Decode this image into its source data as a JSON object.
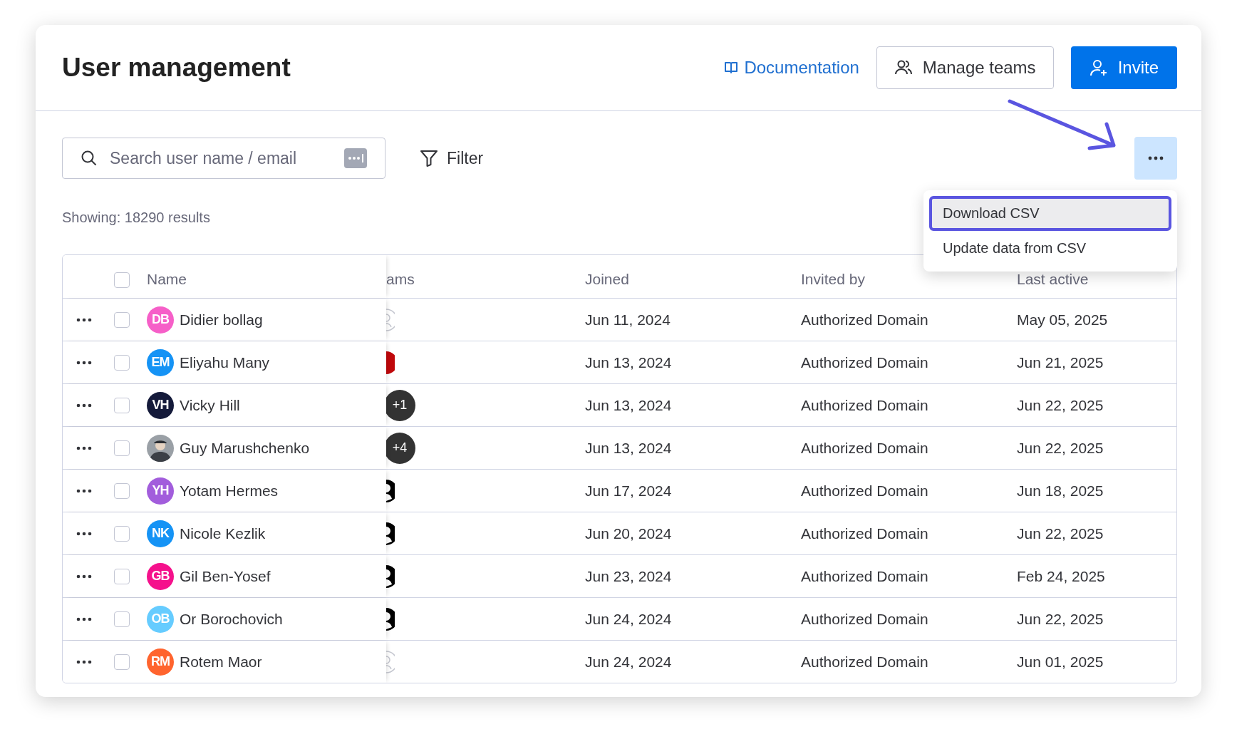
{
  "header": {
    "title": "User management",
    "documentation_link": "Documentation",
    "manage_teams_button": "Manage teams",
    "invite_button": "Invite"
  },
  "toolbar": {
    "search": {
      "placeholder": "Search user name / email"
    },
    "filter_button": "Filter",
    "more_button": {
      "expanded": true
    }
  },
  "results_summary": "Showing: 18290 results",
  "menu": {
    "items": [
      {
        "label": "Download CSV",
        "highlighted": true
      },
      {
        "label": "Update data from CSV",
        "highlighted": false
      }
    ]
  },
  "table": {
    "select_all_checked": false,
    "columns": [
      "Name",
      "ams",
      "Joined",
      "Invited by",
      "Last active"
    ],
    "rows": [
      {
        "initials": "DB",
        "avatar": {
          "kind": "initials"
        },
        "color": "#f65fc8",
        "name": "Didier bollag",
        "teams": {
          "kind": "empty"
        },
        "joined": "Jun 11, 2024",
        "invited_by": "Authorized Domain",
        "last_active": "May 05, 2025",
        "checked": false
      },
      {
        "initials": "EM",
        "avatar": {
          "kind": "initials"
        },
        "color": "#1593f5",
        "name": "Eliyahu Many",
        "teams": {
          "kind": "logo"
        },
        "joined": "Jun 13, 2024",
        "invited_by": "Authorized Domain",
        "last_active": "Jun 21, 2025",
        "checked": false
      },
      {
        "initials": "VH",
        "avatar": {
          "kind": "initials"
        },
        "color": "#141a3a",
        "name": "Vicky Hill",
        "teams": {
          "kind": "count",
          "count": "+1"
        },
        "joined": "Jun 13, 2024",
        "invited_by": "Authorized Domain",
        "last_active": "Jun 22, 2025",
        "checked": false
      },
      {
        "avatar": {
          "kind": "photo"
        },
        "name": "Guy Marushchenko",
        "teams": {
          "kind": "count",
          "count": "+4"
        },
        "joined": "Jun 13, 2024",
        "invited_by": "Authorized Domain",
        "last_active": "Jun 22, 2025",
        "checked": false
      },
      {
        "initials": "YH",
        "avatar": {
          "kind": "initials"
        },
        "color": "#a25ddc",
        "name": "Yotam Hermes",
        "teams": {
          "kind": "person"
        },
        "joined": "Jun 17, 2024",
        "invited_by": "Authorized Domain",
        "last_active": "Jun 18, 2025",
        "checked": false
      },
      {
        "initials": "NK",
        "avatar": {
          "kind": "initials"
        },
        "color": "#1593f5",
        "name": "Nicole Kezlik",
        "teams": {
          "kind": "person"
        },
        "joined": "Jun 20, 2024",
        "invited_by": "Authorized Domain",
        "last_active": "Jun 22, 2025",
        "checked": false
      },
      {
        "initials": "GB",
        "avatar": {
          "kind": "initials"
        },
        "color": "#f5118c",
        "name": "Gil Ben-Yosef",
        "teams": {
          "kind": "person"
        },
        "joined": "Jun 23, 2024",
        "invited_by": "Authorized Domain",
        "last_active": "Feb 24, 2025",
        "checked": false
      },
      {
        "initials": "OB",
        "avatar": {
          "kind": "initials"
        },
        "color": "#66ccff",
        "name": "Or Borochovich",
        "teams": {
          "kind": "person"
        },
        "joined": "Jun 24, 2024",
        "invited_by": "Authorized Domain",
        "last_active": "Jun 22, 2025",
        "checked": false
      },
      {
        "initials": "RM",
        "avatar": {
          "kind": "initials"
        },
        "color": "#ff642e",
        "name": "Rotem Maor",
        "teams": {
          "kind": "empty"
        },
        "joined": "Jun 24, 2024",
        "invited_by": "Authorized Domain",
        "last_active": "Jun 01, 2025",
        "checked": false
      }
    ]
  }
}
